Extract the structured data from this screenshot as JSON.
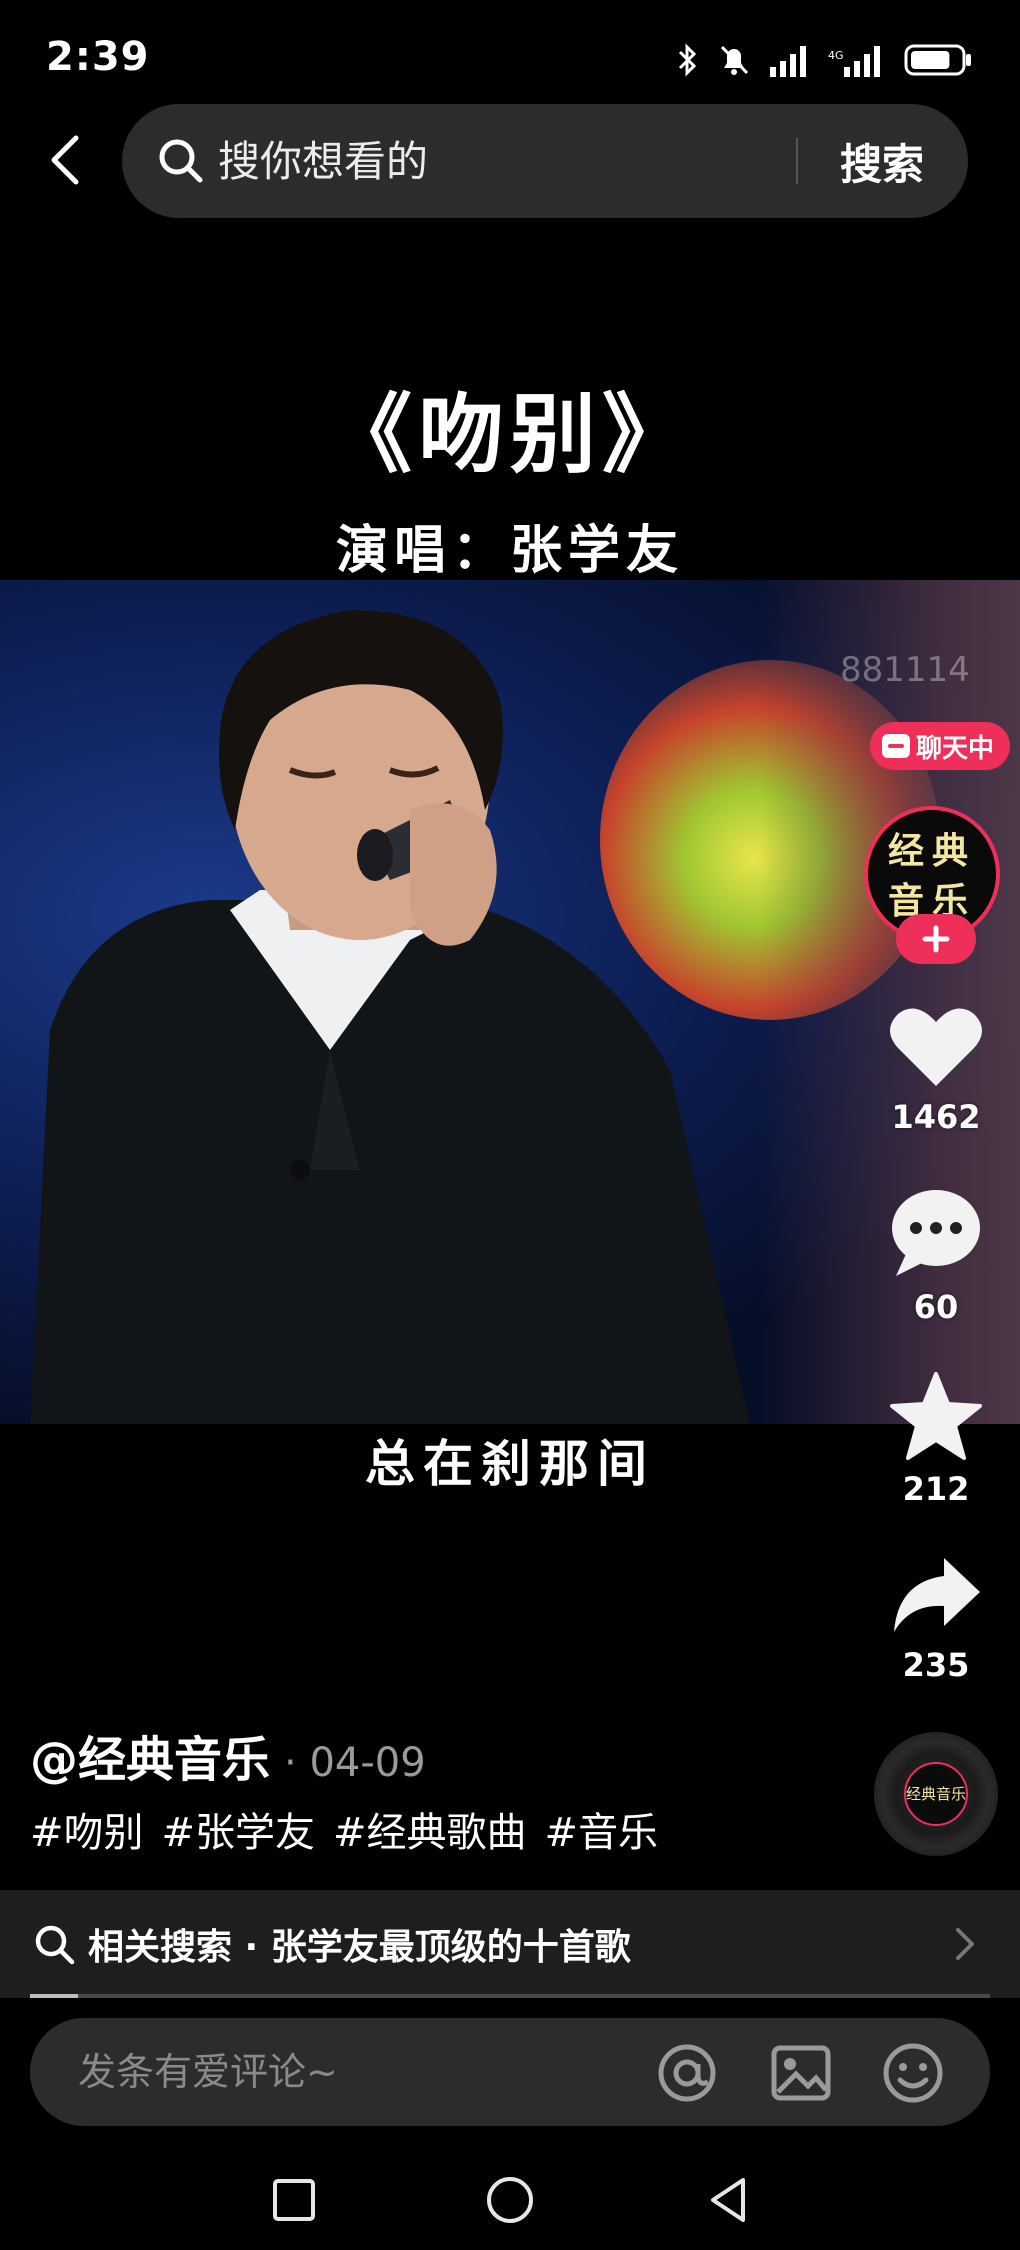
{
  "status_bar": {
    "time": "2:39",
    "battery_level": 0.8
  },
  "search": {
    "placeholder": "搜你想看的",
    "submit_label": "搜索"
  },
  "video": {
    "title": "《吻别》",
    "singer_line": "演唱：张学友",
    "lyric": "总在刹那间",
    "watermark": "881114"
  },
  "author": {
    "avatar_text": "经典音乐",
    "name": "@经典音乐",
    "date": "04-09",
    "chat_badge": "聊天中"
  },
  "actions": {
    "likes": "1462",
    "comments": "60",
    "favorites": "212",
    "shares": "235"
  },
  "hashtags": [
    "#吻别",
    "#张学友",
    "#经典歌曲",
    "#音乐"
  ],
  "related": {
    "text": "相关搜索 · 张学友最顶级的十首歌"
  },
  "playback": {
    "progress": 0.05
  },
  "comment": {
    "placeholder": "发条有爱评论~"
  },
  "colors": {
    "accent": "#ee2f5a",
    "background": "#000000",
    "bar": "#2c2c2c"
  }
}
